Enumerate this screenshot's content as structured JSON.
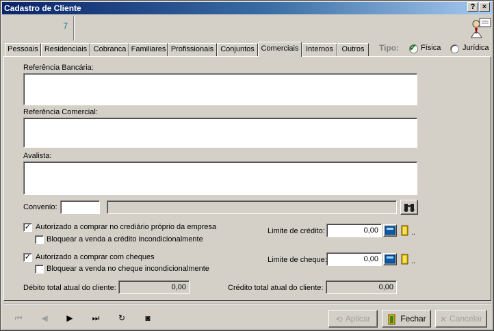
{
  "window": {
    "title": "Cadastro de Cliente",
    "help": "?",
    "close": "×"
  },
  "record": {
    "number": "7"
  },
  "tabs": [
    "Pessoais",
    "Residenciais",
    "Cobranca",
    "Familiares",
    "Profissionais",
    "Conjuntos",
    "Comerciais",
    "Internos",
    "Outros"
  ],
  "active_tab": "Comerciais",
  "tipo": {
    "label": "Tipo:",
    "fisica": "Física",
    "juridica": "Jurídica",
    "selected": "Física"
  },
  "form": {
    "ref_bancaria_label": "Referência Bancária:",
    "ref_comercial_label": "Referência Comercial:",
    "avalista_label": "Avalista:",
    "convenio_label": "Convenio:",
    "convenio_code": "",
    "convenio_name": "",
    "crediario_label": "Autorizado a comprar no crediário próprio da empresa",
    "crediario_checked": true,
    "bloquear_credito_label": "Bloquear a venda a crédito incondicionalmente",
    "bloquear_credito_checked": false,
    "cheques_label": "Autorizado a comprar com cheques",
    "cheques_checked": true,
    "bloquear_cheque_label": "Bloquear a venda no cheque incondicionalmente",
    "bloquear_cheque_checked": false,
    "limite_credito_label": "Limite de crédito:",
    "limite_credito_value": "0,00",
    "limite_cheque_label": "Limite de cheque:",
    "limite_cheque_value": "0,00",
    "debito_label": "Débito total atual do cliente:",
    "debito_value": "0,00",
    "credito_label": "Crédito total atual do cliente:",
    "credito_value": "0,00",
    "ellipsis": ".."
  },
  "buttons": {
    "aplicar": "Aplicar",
    "fechar": "Fechar",
    "cancelar": "Cancelar"
  },
  "colors": {
    "titlebar": "#0a246a",
    "face": "#d4d0c8",
    "accent_number": "#0a7a8f"
  }
}
